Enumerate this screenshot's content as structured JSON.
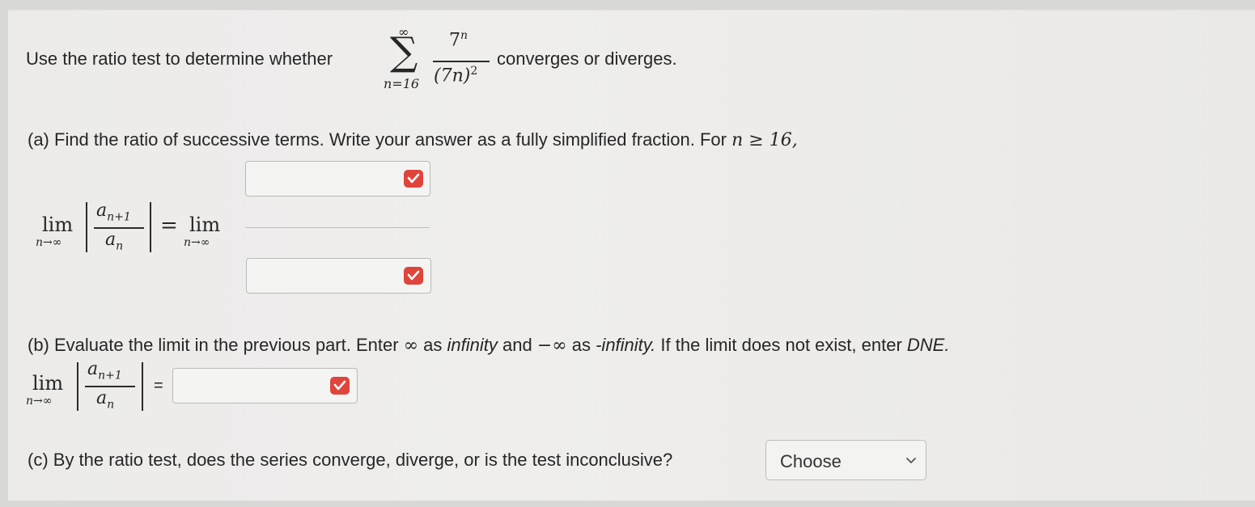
{
  "question": {
    "intro": "Use the ratio test to determine whether",
    "suffix": "converges or diverges.",
    "series": {
      "sum_upper": "∞",
      "sum_lower": "n=16",
      "numerator_base": "7",
      "numerator_exp": "n",
      "denominator": "(7n)",
      "denominator_exp": "2"
    }
  },
  "part_a": {
    "text": "(a) Find the ratio of successive terms. Write your answer as a fully simplified fraction. For",
    "condition": "n ≥ 16,",
    "lim": "lim",
    "lim_sub": "n→∞",
    "ratio_num": "a",
    "ratio_num_sub": "n+1",
    "ratio_den": "a",
    "ratio_den_sub": "n",
    "equals": "=",
    "numerator_value": "",
    "denominator_value": ""
  },
  "part_b": {
    "prefix": "(b) Evaluate the limit in the previous part. Enter",
    "inf_symbol": "∞",
    "as1": "as",
    "infinity_word": "infinity",
    "and": "and",
    "neg_inf_symbol": "−∞",
    "as2": "as",
    "neg_infinity_word": "-infinity.",
    "dne_text": "If the limit does not exist, enter",
    "dne_word": "DNE.",
    "lim": "lim",
    "lim_sub": "n→∞",
    "ratio_num": "a",
    "ratio_num_sub": "n+1",
    "ratio_den": "a",
    "ratio_den_sub": "n",
    "equals": "=",
    "answer_value": ""
  },
  "part_c": {
    "text": "(c) By the ratio test, does the series converge, diverge, or is the test inconclusive?",
    "select_value": "Choose"
  },
  "colors": {
    "check_icon_bg": "#e0453b",
    "background": "#eeedec"
  },
  "icons": {
    "answer_check": "check-icon",
    "dropdown": "chevron-down-icon"
  }
}
